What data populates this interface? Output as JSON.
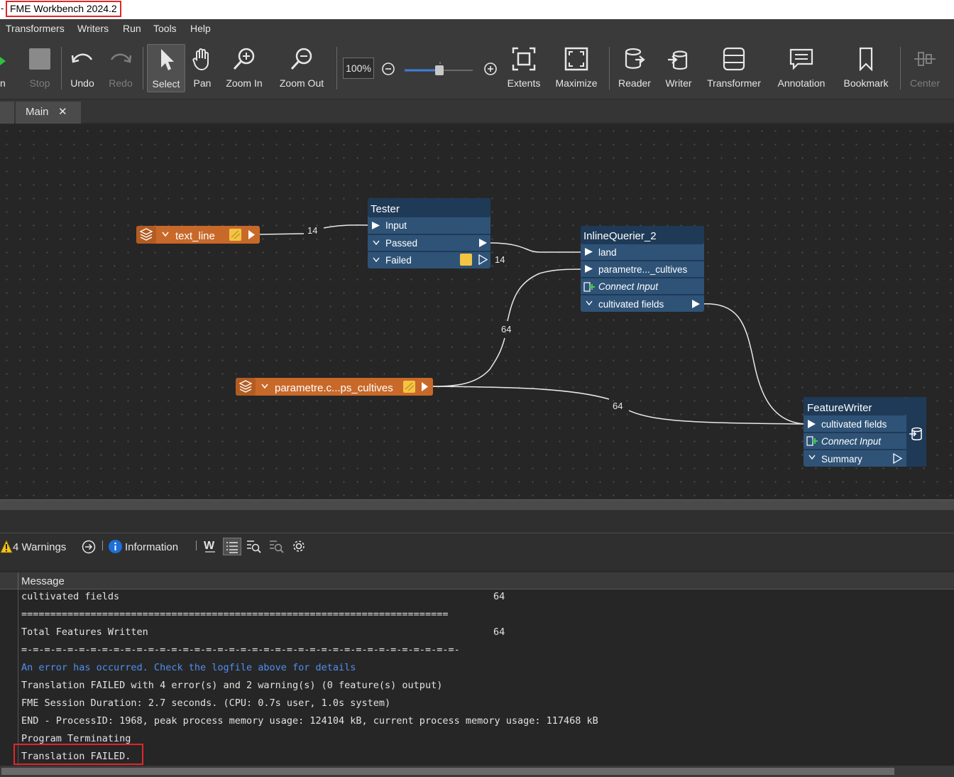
{
  "window": {
    "title": "FME Workbench 2024.2"
  },
  "menu": [
    "Transformers",
    "Writers",
    "Run",
    "Tools",
    "Help"
  ],
  "toolbar": {
    "run_partial": "n",
    "stop": "Stop",
    "undo": "Undo",
    "redo": "Redo",
    "select": "Select",
    "pan": "Pan",
    "zoom_in": "Zoom In",
    "zoom_out": "Zoom Out",
    "zoom_level": "100%",
    "extents": "Extents",
    "maximize": "Maximize",
    "reader": "Reader",
    "writer": "Writer",
    "transformer": "Transformer",
    "annotation": "Annotation",
    "bookmark": "Bookmark",
    "center": "Center"
  },
  "tabs": [
    {
      "label": "Main",
      "close": "✕"
    }
  ],
  "canvas": {
    "reader_text_line": "text_line",
    "reader_parametre": "parametre.c...ps_cultives",
    "tester": {
      "title": "Tester",
      "input": "Input",
      "passed": "Passed",
      "failed": "Failed"
    },
    "inlinequerier": {
      "title": "InlineQuerier_2",
      "port1": "land",
      "port2": "parametre..._cultives",
      "connect": "Connect Input",
      "output": "cultivated fields"
    },
    "featurewriter": {
      "title": "FeatureWriter",
      "port1": "cultivated fields",
      "connect": "Connect Input",
      "summary": "Summary"
    },
    "counts": {
      "text_line_to_tester": "14",
      "failed": "14",
      "param_to_querier": "64",
      "param_to_writer": "64"
    }
  },
  "log": {
    "warnings": "4 Warnings",
    "information": "Information",
    "column_header": "Message",
    "lines": [
      {
        "text": "cultivated fields",
        "count": "64"
      },
      {
        "text": "=========================================================================="
      },
      {
        "text": "Total Features Written",
        "count": "64"
      },
      {
        "text": "=-=-=-=-=-=-=-=-=-=-=-=-=-=-=-=-=-=-=-=-=-=-=-=-=-=-=-=-=-=-=-=-=-=-=-=-=-=-"
      },
      {
        "text": "An error has occurred. Check the logfile above for details",
        "kind": "error"
      },
      {
        "text": "Translation FAILED with 4 error(s) and 2 warning(s) (0 feature(s) output)"
      },
      {
        "text": "FME Session Duration: 2.7 seconds. (CPU: 0.7s user, 1.0s system)"
      },
      {
        "text": "END - ProcessID: 1968, peak process memory usage: 124104 kB, current process memory usage: 117468 kB"
      },
      {
        "text": "Program Terminating"
      },
      {
        "text": "Translation FAILED."
      }
    ]
  },
  "colors": {
    "reader": "#c8692a",
    "transformer": "#2f5377",
    "transformer_header": "#1f3a57",
    "highlight": "#e0262a"
  }
}
